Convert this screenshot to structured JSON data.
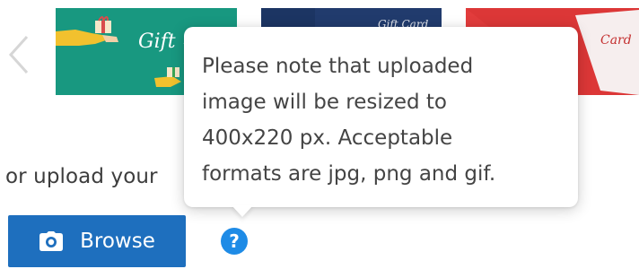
{
  "carousel": {
    "prev_icon": "chevron-left-icon",
    "thumbnails": [
      {
        "name": "gift-card-teal",
        "color": "#1a9c83"
      },
      {
        "name": "gift-card-navy",
        "color": "#1c3563"
      },
      {
        "name": "gift-card-red",
        "color": "#e23c3c"
      }
    ]
  },
  "upload": {
    "label": "or upload your"
  },
  "browse_button": {
    "icon": "camera-icon",
    "label": "Browse",
    "color": "#1e6fbe"
  },
  "help": {
    "icon_glyph": "?",
    "color": "#1e8be6"
  },
  "tooltip": {
    "lines": [
      "Please note that uploaded",
      "image will be resized to",
      "400x220 px. Acceptable",
      "formats are jpg, png and gif."
    ]
  }
}
